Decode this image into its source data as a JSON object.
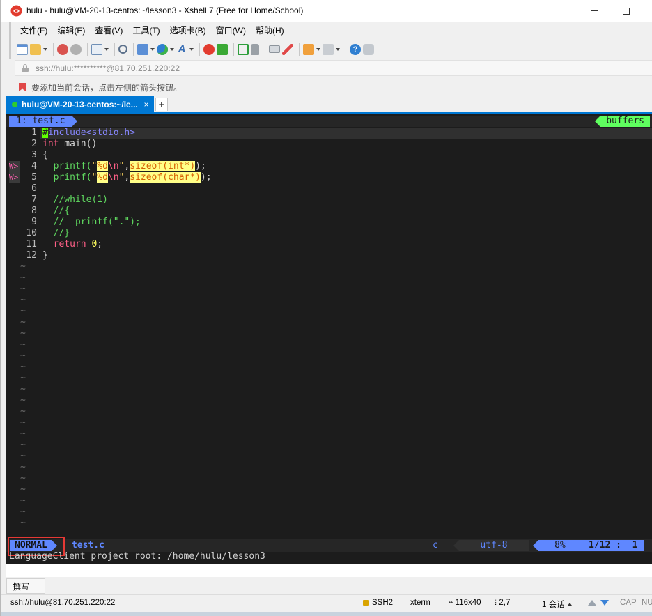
{
  "window": {
    "title": "hulu - hulu@VM-20-13-centos:~/lesson3 - Xshell 7 (Free for Home/School)",
    "minimize_glyph": "—",
    "maximize_glyph": "☐"
  },
  "menu": [
    "文件(F)",
    "编辑(E)",
    "查看(V)",
    "工具(T)",
    "选项卡(B)",
    "窗口(W)",
    "帮助(H)"
  ],
  "address": {
    "text": "ssh://hulu:**********@81.70.251.220:22"
  },
  "hint": {
    "text": "要添加当前会话，点击左侧的箭头按钮。"
  },
  "tabs": {
    "active_label": "hulu@VM-20-13-centos:~/le...",
    "close_glyph": "×",
    "add_glyph": "+"
  },
  "vim": {
    "buffer_tab": "1: test.c",
    "buffers_label": "buffers",
    "lines": [
      {
        "n": "1",
        "sign": ""
      },
      {
        "n": "2",
        "sign": ""
      },
      {
        "n": "3",
        "sign": ""
      },
      {
        "n": "4",
        "sign": "W>"
      },
      {
        "n": "5",
        "sign": "W>"
      },
      {
        "n": "6",
        "sign": ""
      },
      {
        "n": "7",
        "sign": ""
      },
      {
        "n": "8",
        "sign": ""
      },
      {
        "n": "9",
        "sign": ""
      },
      {
        "n": "10",
        "sign": ""
      },
      {
        "n": "11",
        "sign": ""
      },
      {
        "n": "12",
        "sign": ""
      }
    ],
    "code": {
      "l1_cursor": "#",
      "l1_rest": "include<stdio.h>",
      "l2_type": "int",
      "l2_rest": " main()",
      "l3": "{",
      "l4_a": "  printf(",
      "l4_q1": "\"",
      "l4_fmt": "%d",
      "l4_esc": "\\n",
      "l4_q2": "\"",
      "l4_comma": ",",
      "l4_sizeof": "sizeof(int*)",
      "l4_end": ");",
      "l5_a": "  printf(",
      "l5_q1": "\"",
      "l5_fmt": "%d",
      "l5_esc": "\\n",
      "l5_q2": "\"",
      "l5_comma": ",",
      "l5_sizeof": "sizeof(char*)",
      "l5_end": ");",
      "l7": "  //while(1)",
      "l8": "  //{",
      "l9": "  //  printf(\".\");",
      "l10": "  //}",
      "l11_kw": "  return",
      "l11_num": "0",
      "l11_end": ";",
      "l12": "}"
    },
    "tilde": "~",
    "status": {
      "mode": "NORMAL",
      "file": "test.c",
      "filetype": "c",
      "encoding": "utf-8",
      "percent": "8%",
      "position": "1/12 :  1"
    },
    "message": "LanguageClient project root: /home/hulu/lesson3"
  },
  "compose": {
    "tab_label": "撰写"
  },
  "statusbar": {
    "address": "ssh://hulu@81.70.251.220:22",
    "protocol": "SSH2",
    "terminal": "xterm",
    "size": "116x40",
    "cursor": "2,7",
    "sessions": "1 会话",
    "caps": "CAP",
    "num": "NU"
  },
  "colors": {
    "accent": "#0078d4",
    "terminal_bg": "#1c1c1c",
    "mode_blue": "#5f87ff",
    "buffers_green": "#5fff5f",
    "warning_pink": "#ff5faf",
    "highlight_box": "#e53935"
  }
}
